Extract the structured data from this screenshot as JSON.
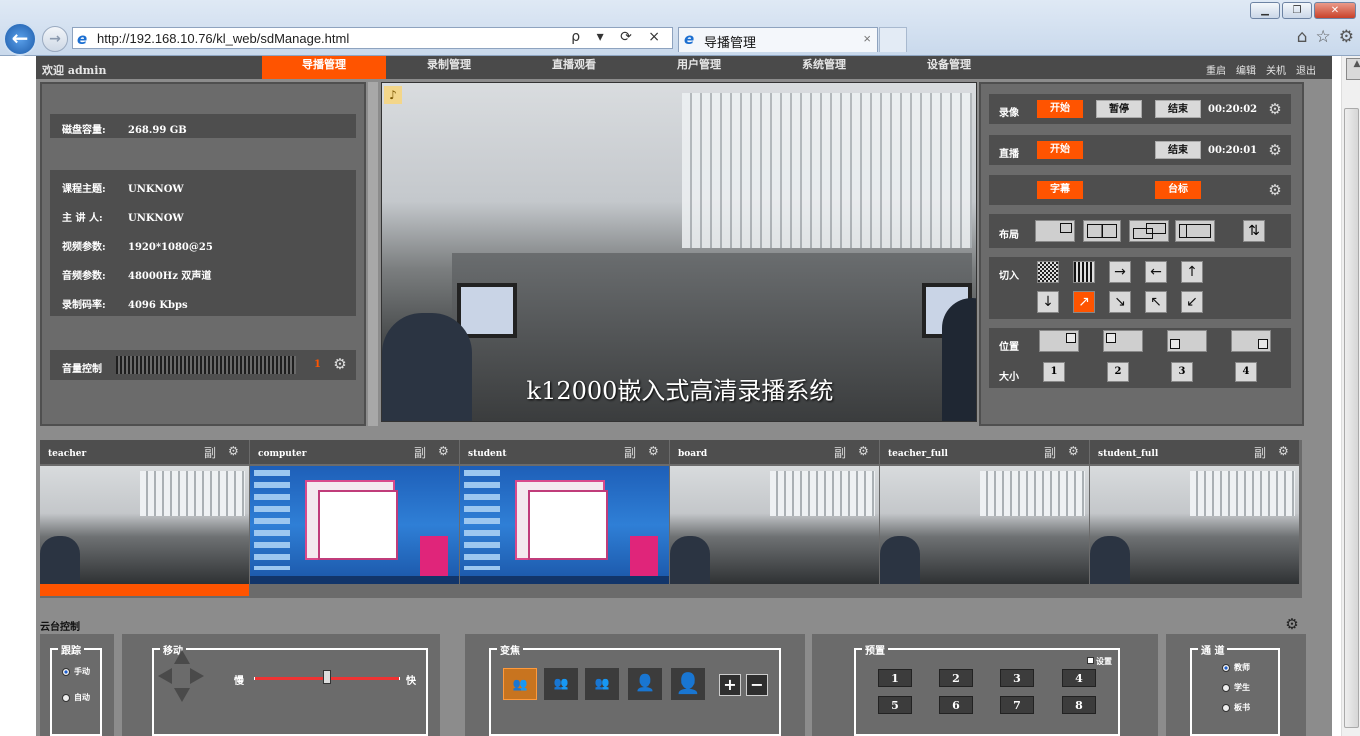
{
  "browser": {
    "url": "http://192.168.10.76/kl_web/sdManage.html",
    "tab_title": "导播管理",
    "tab_close": "×",
    "tools": "ρ ▾ ⟳ ×"
  },
  "topnav": {
    "welcome": "欢迎 admin",
    "menus": [
      "导播管理",
      "录制管理",
      "直播观看",
      "用户管理",
      "系统管理",
      "设备管理"
    ],
    "active_menu": "导播管理",
    "right_links": [
      "重启",
      "编辑",
      "关机",
      "退出"
    ]
  },
  "info": {
    "disk_label": "磁盘容量:",
    "disk_value": "268.99 GB",
    "rows": [
      {
        "label": "课程主题:",
        "value": "UNKNOW"
      },
      {
        "label": "主 讲 人:",
        "value": "UNKNOW"
      },
      {
        "label": "视频参数:",
        "value": "1920*1080@25"
      },
      {
        "label": "音频参数:",
        "value": "48000Hz 双声道"
      },
      {
        "label": "录制码率:",
        "value": "4096 Kbps"
      }
    ],
    "volume_label": "音量控制",
    "volume_value": "1"
  },
  "preview": {
    "caption": "k12000嵌入式高清录播系统"
  },
  "controls": {
    "record_label": "录像",
    "record_start": "开始",
    "record_pause": "暂停",
    "record_stop": "结束",
    "record_time": "00:20:02",
    "live_label": "直播",
    "live_start": "开始",
    "live_stop": "结束",
    "live_time": "00:20:01",
    "subtitle_btn": "字幕",
    "logo_btn": "台标",
    "layout_label": "布局",
    "cut_label": "切入",
    "position_label": "位置",
    "size_label": "大小",
    "sizes": [
      "1",
      "2",
      "3",
      "4"
    ],
    "arrows_row1": [
      "→",
      "←",
      "↑"
    ],
    "arrows_row2": [
      "↓",
      "↗",
      "↘",
      "↖",
      "↙"
    ],
    "swap_icon": "⇅"
  },
  "thumbs": [
    {
      "name": "teacher",
      "badge": "副",
      "kind": "cam"
    },
    {
      "name": "computer",
      "badge": "副",
      "kind": "desk"
    },
    {
      "name": "student",
      "badge": "副",
      "kind": "desk"
    },
    {
      "name": "board",
      "badge": "副",
      "kind": "cam"
    },
    {
      "name": "teacher_full",
      "badge": "副",
      "kind": "cam"
    },
    {
      "name": "student_full",
      "badge": "副",
      "kind": "cam"
    }
  ],
  "ptz": {
    "title": "云台控制",
    "track_label": "跟踪",
    "track_manual": "手动",
    "track_auto": "自动",
    "move_label": "移动",
    "slow": "慢",
    "fast": "快",
    "speed_percent": 50,
    "zoom_label": "变焦",
    "zoom_plus": "+",
    "zoom_minus": "−",
    "preset_label": "预置",
    "preset_set": "设置",
    "presets": [
      "1",
      "2",
      "3",
      "4",
      "5",
      "6",
      "7",
      "8"
    ],
    "channel_label": "通 道",
    "channels": [
      "教师",
      "学生",
      "板书"
    ]
  },
  "colors": {
    "accent": "#ff5400",
    "panel": "#6b6b6b",
    "row": "#4e4e4e"
  }
}
